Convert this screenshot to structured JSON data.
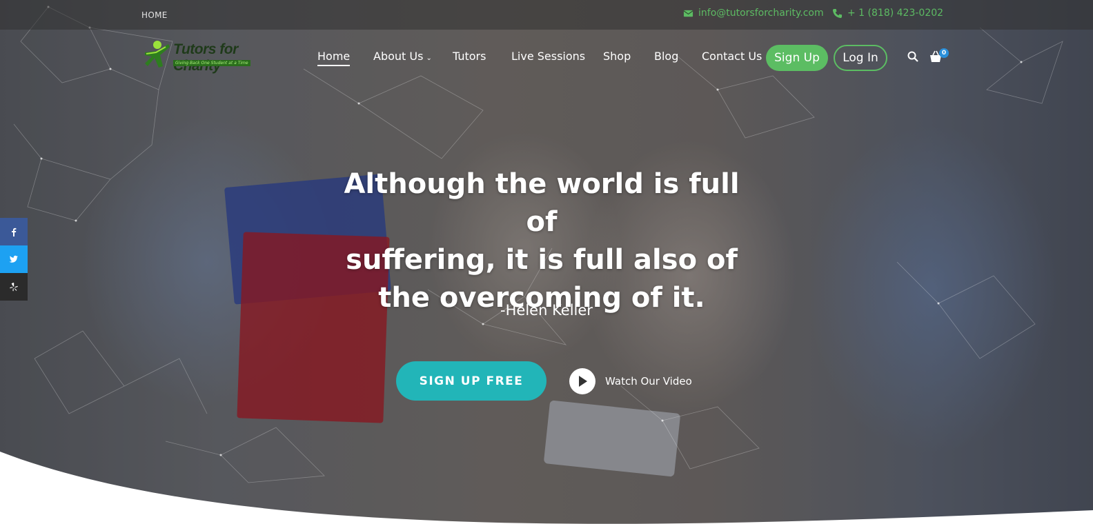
{
  "topbar": {
    "breadcrumb": "HOME",
    "email": "info@tutorsforcharity.com",
    "phone": "+ 1 (818) 423-0202"
  },
  "logo": {
    "title": "Tutors for Charity",
    "tagline": "Giving Back One Student at a Time"
  },
  "nav": {
    "items": [
      {
        "label": "Home",
        "active": true
      },
      {
        "label": "About Us",
        "has_dropdown": true
      },
      {
        "label": "Tutors"
      },
      {
        "label": "Live Sessions"
      },
      {
        "label": "Shop"
      },
      {
        "label": "Blog"
      },
      {
        "label": "Contact Us"
      }
    ],
    "signup_label": "Sign Up",
    "login_label": "Log In",
    "cart_count": "0"
  },
  "hero": {
    "quote_lines": [
      "Although the world is full of",
      "suffering, it is full also of",
      "the overcoming of it."
    ],
    "author": "-Helen Keller",
    "cta_label": "SIGN UP FREE",
    "video_label": "Watch Our Video"
  },
  "social": [
    {
      "icon": "facebook-icon"
    },
    {
      "icon": "twitter-icon"
    },
    {
      "icon": "yelp-icon"
    }
  ],
  "colors": {
    "accent_green": "#5cbd63",
    "cta_teal": "#22b5b8",
    "facebook": "#3b5998",
    "twitter": "#1da1f2",
    "yelp": "#2b2b2b"
  }
}
